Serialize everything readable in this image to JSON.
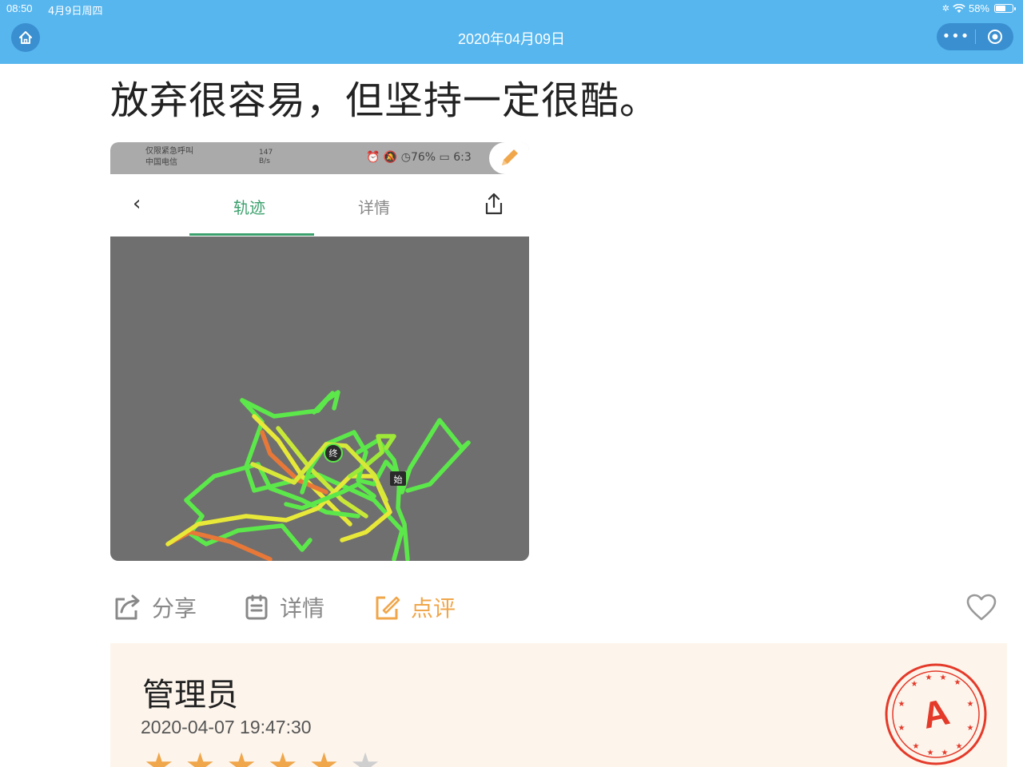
{
  "status_bar": {
    "time": "08:50",
    "date": "4月9日周四",
    "battery": "58%"
  },
  "nav": {
    "title": "2020年04月09日",
    "more_label": "•••"
  },
  "post": {
    "headline": "放弃很容易，但坚持一定很酷。"
  },
  "embedded_screenshot": {
    "carrier_line1": "仅限紧急呼叫",
    "carrier_line2": "中国电信",
    "net_speed": "147",
    "net_speed_unit": "B/s",
    "status_icons": "⏰ 🔕 ◷76% ▭ 6:3",
    "back": "‹",
    "tab_track": "轨迹",
    "tab_detail": "详情",
    "marker_end": "终",
    "marker_start": "始"
  },
  "actions": {
    "share": "分享",
    "detail": "详情",
    "review": "点评"
  },
  "comment": {
    "author": "管理员",
    "timestamp": "2020-04-07 19:47:30",
    "rating": 5,
    "rating_max": 6,
    "stamp_letter": "A"
  },
  "colors": {
    "nav_bg": "#57b6ee",
    "accent_green": "#3aa06c",
    "accent_orange": "#f0a64a",
    "map_bg": "#6f6f6f",
    "route_green": "#5ce84a",
    "route_yellow": "#e8e838",
    "stamp_red": "#e43a2a"
  }
}
